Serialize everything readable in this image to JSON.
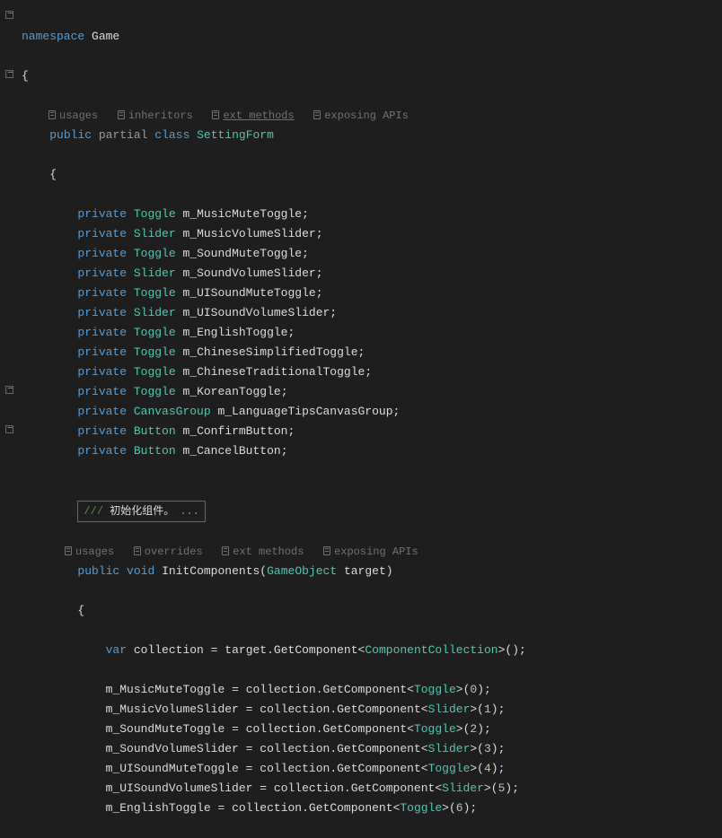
{
  "namespace_kw": "namespace",
  "namespace_name": "Game",
  "class_hints": {
    "usages": "usages",
    "inheritors": "inheritors",
    "ext_methods": "ext methods",
    "exposing_apis": "exposing APIs"
  },
  "class": {
    "public": "public",
    "partial": "partial",
    "class_kw": "class",
    "name": "SettingForm"
  },
  "private_kw": "private",
  "fields": [
    {
      "type": "Toggle",
      "name": "m_MusicMuteToggle"
    },
    {
      "type": "Slider",
      "name": "m_MusicVolumeSlider"
    },
    {
      "type": "Toggle",
      "name": "m_SoundMuteToggle"
    },
    {
      "type": "Slider",
      "name": "m_SoundVolumeSlider"
    },
    {
      "type": "Toggle",
      "name": "m_UISoundMuteToggle"
    },
    {
      "type": "Slider",
      "name": "m_UISoundVolumeSlider"
    },
    {
      "type": "Toggle",
      "name": "m_EnglishToggle"
    },
    {
      "type": "Toggle",
      "name": "m_ChineseSimplifiedToggle"
    },
    {
      "type": "Toggle",
      "name": "m_ChineseTraditionalToggle"
    },
    {
      "type": "Toggle",
      "name": "m_KoreanToggle"
    },
    {
      "type": "CanvasGroup",
      "name": "m_LanguageTipsCanvasGroup"
    },
    {
      "type": "Button",
      "name": "m_ConfirmButton"
    },
    {
      "type": "Button",
      "name": "m_CancelButton"
    }
  ],
  "folded_comment": {
    "slashes": "///",
    "text": "初始化组件。",
    "ellipsis": "..."
  },
  "method_hints": {
    "usages": "usages",
    "overrides": "overrides",
    "ext_methods": "ext methods",
    "exposing_apis": "exposing APIs"
  },
  "method": {
    "public": "public",
    "void": "void",
    "name": "InitComponents",
    "param_type": "GameObject",
    "param_name": "target"
  },
  "var_kw": "var",
  "collection_var": "collection",
  "target_ref": "target",
  "get_component": "GetComponent",
  "collection_type": "ComponentCollection",
  "assignments": [
    {
      "field": "m_MusicMuteToggle",
      "type": "Toggle",
      "idx": "0"
    },
    {
      "field": "m_MusicVolumeSlider",
      "type": "Slider",
      "idx": "1"
    },
    {
      "field": "m_SoundMuteToggle",
      "type": "Toggle",
      "idx": "2"
    },
    {
      "field": "m_SoundVolumeSlider",
      "type": "Slider",
      "idx": "3"
    },
    {
      "field": "m_UISoundMuteToggle",
      "type": "Toggle",
      "idx": "4"
    },
    {
      "field": "m_UISoundVolumeSlider",
      "type": "Slider",
      "idx": "5"
    },
    {
      "field": "m_EnglishToggle",
      "type": "Toggle",
      "idx": "6"
    }
  ]
}
